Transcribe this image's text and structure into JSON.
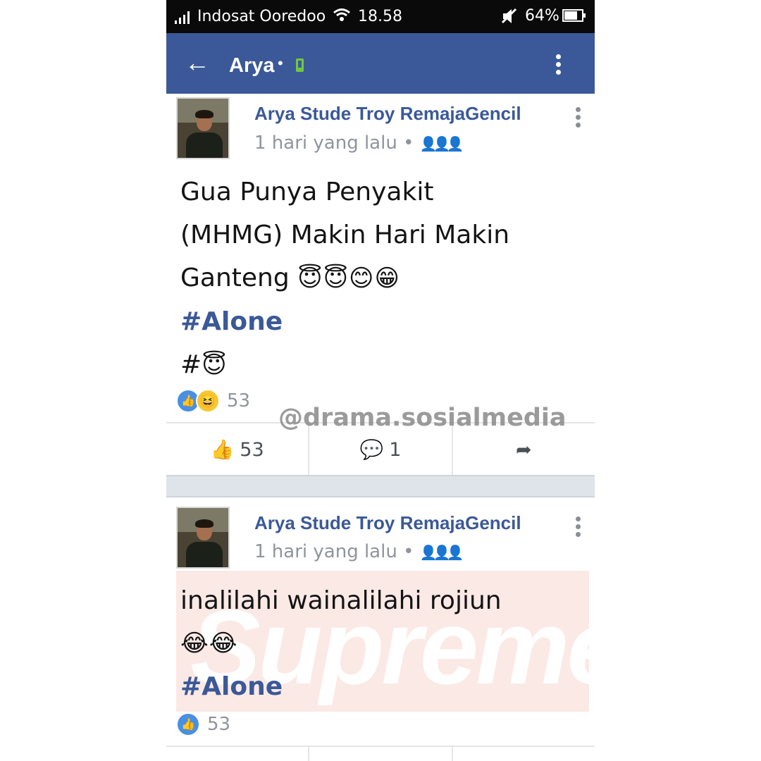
{
  "status_bar": {
    "carrier": "Indosat Ooredoo",
    "time": "18.58",
    "battery": "64%",
    "battery_level": 0.64
  },
  "app_bar": {
    "back_icon": "←",
    "title": "Arya",
    "separator": "•",
    "status_icon": "mobile-online-icon"
  },
  "posts": [
    {
      "author": "Arya Stude Troy RemajaGencil",
      "time": "1 hari yang lalu •",
      "audience_icon": "👤👤👤",
      "lines": [
        "Gua Punya Penyakit",
        "(MHMG) Makin Hari Makin",
        "Ganteng"
      ],
      "emoji": "😇😇😊😁",
      "hashtag": "#Alone",
      "hash_prefix": "#",
      "hash_emoji": "😇",
      "reaction_count": "53",
      "actions": {
        "like_icon": "👍",
        "like": "53",
        "comment_icon": "💬",
        "comment": "1",
        "share_icon": "➦"
      }
    },
    {
      "author": "Arya Stude Troy RemajaGencil",
      "time": "1 hari yang lalu •",
      "audience_icon": "👤👤👤",
      "lines": [
        "inalilahi wainalilahi rojiun"
      ],
      "emoji": "😂😂",
      "hashtag": "#Alone",
      "reaction_count": "53",
      "sticker_text": "Supreme"
    }
  ],
  "watermark": "@drama.sosialmedia",
  "colors": {
    "brand": "#3b5998",
    "status_bar": "#0a0a0a",
    "like": "#4a90e2",
    "online": "#6fca3f"
  }
}
